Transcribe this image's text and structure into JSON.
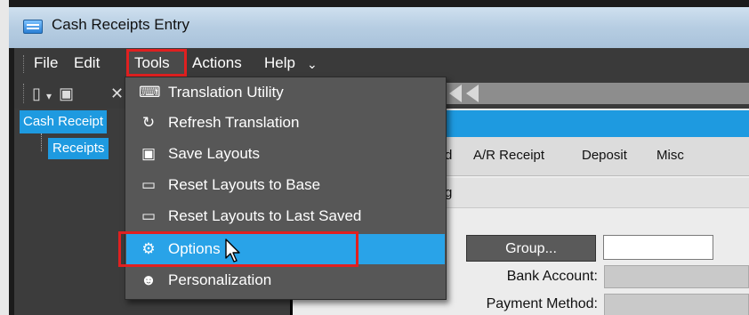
{
  "window": {
    "title": "Cash Receipts Entry"
  },
  "menubar": {
    "items": [
      {
        "label": "File"
      },
      {
        "label": "Edit"
      },
      {
        "label": "Tools"
      },
      {
        "label": "Actions"
      },
      {
        "label": "Help"
      }
    ]
  },
  "tools_menu": {
    "items": [
      {
        "label": "Translation Utility",
        "icon": "keyboard-icon"
      },
      {
        "label": "Refresh Translation",
        "icon": "refresh-icon"
      },
      {
        "label": "Save Layouts",
        "icon": "save-icon"
      },
      {
        "label": "Reset Layouts to Base",
        "icon": "window-icon"
      },
      {
        "label": "Reset Layouts to Last Saved",
        "icon": "window-icon"
      },
      {
        "label": "Options",
        "icon": "options-icon",
        "highlighted": true
      },
      {
        "label": "Personalization",
        "icon": "person-icon"
      }
    ]
  },
  "tree": {
    "root": "Cash Receipt",
    "child": "Receipts"
  },
  "tabs": {
    "partial": "d",
    "items": [
      "A/R Receipt",
      "Deposit",
      "Misc"
    ],
    "subtab_partial": "g"
  },
  "form": {
    "group_button": "Group...",
    "bank_account_label": "Bank Account:",
    "payment_method_label": "Payment Method:"
  },
  "colors": {
    "accent": "#29a3e8",
    "highlight_box": "#e02020",
    "menu_bg": "#575757"
  }
}
